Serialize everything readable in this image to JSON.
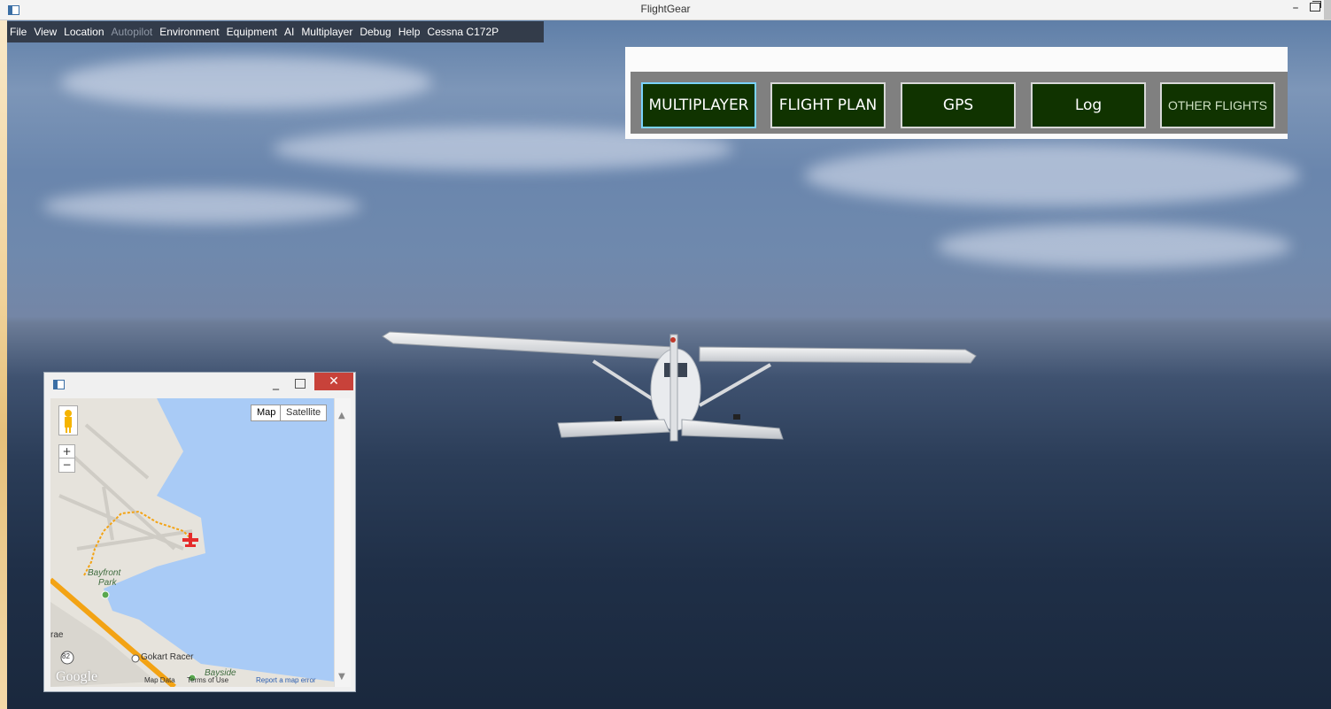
{
  "window": {
    "title": "FlightGear"
  },
  "menu": {
    "items": [
      {
        "label": "File",
        "enabled": true
      },
      {
        "label": "View",
        "enabled": true
      },
      {
        "label": "Location",
        "enabled": true
      },
      {
        "label": "Autopilot",
        "enabled": false
      },
      {
        "label": "Environment",
        "enabled": true
      },
      {
        "label": "Equipment",
        "enabled": true
      },
      {
        "label": "AI",
        "enabled": true
      },
      {
        "label": "Multiplayer",
        "enabled": true
      },
      {
        "label": "Debug",
        "enabled": true
      },
      {
        "label": "Help",
        "enabled": true
      },
      {
        "label": "Cessna C172P",
        "enabled": true
      }
    ]
  },
  "panel": {
    "buttons": [
      {
        "label": "MULTIPLAYER",
        "active": true
      },
      {
        "label": "FLIGHT PLAN",
        "active": false
      },
      {
        "label": "GPS",
        "active": false
      },
      {
        "label": "Log",
        "active": false
      },
      {
        "label": "OTHER FLIGHTS",
        "active": false
      }
    ]
  },
  "map": {
    "type_buttons": {
      "map": "Map",
      "satellite": "Satellite"
    },
    "zoom": {
      "in": "+",
      "out": "−"
    },
    "labels": {
      "bayfront": "Bayfront",
      "park": "Park",
      "gokart": "Gokart Racer",
      "bayside": "Bayside",
      "route_82": "82",
      "rae": "rae"
    },
    "footer": {
      "google": "Google",
      "map_data": "Map Data",
      "terms": "Terms of Use",
      "report": "Report a map error"
    },
    "close_glyph": "✕",
    "min_glyph": "_"
  },
  "colors": {
    "panel_button_bg": "#103300",
    "active_button_border": "#7ad3ff",
    "map_water": "#a9cbf6",
    "route": "#f3a314",
    "aircraft_marker": "#e52b2b"
  }
}
